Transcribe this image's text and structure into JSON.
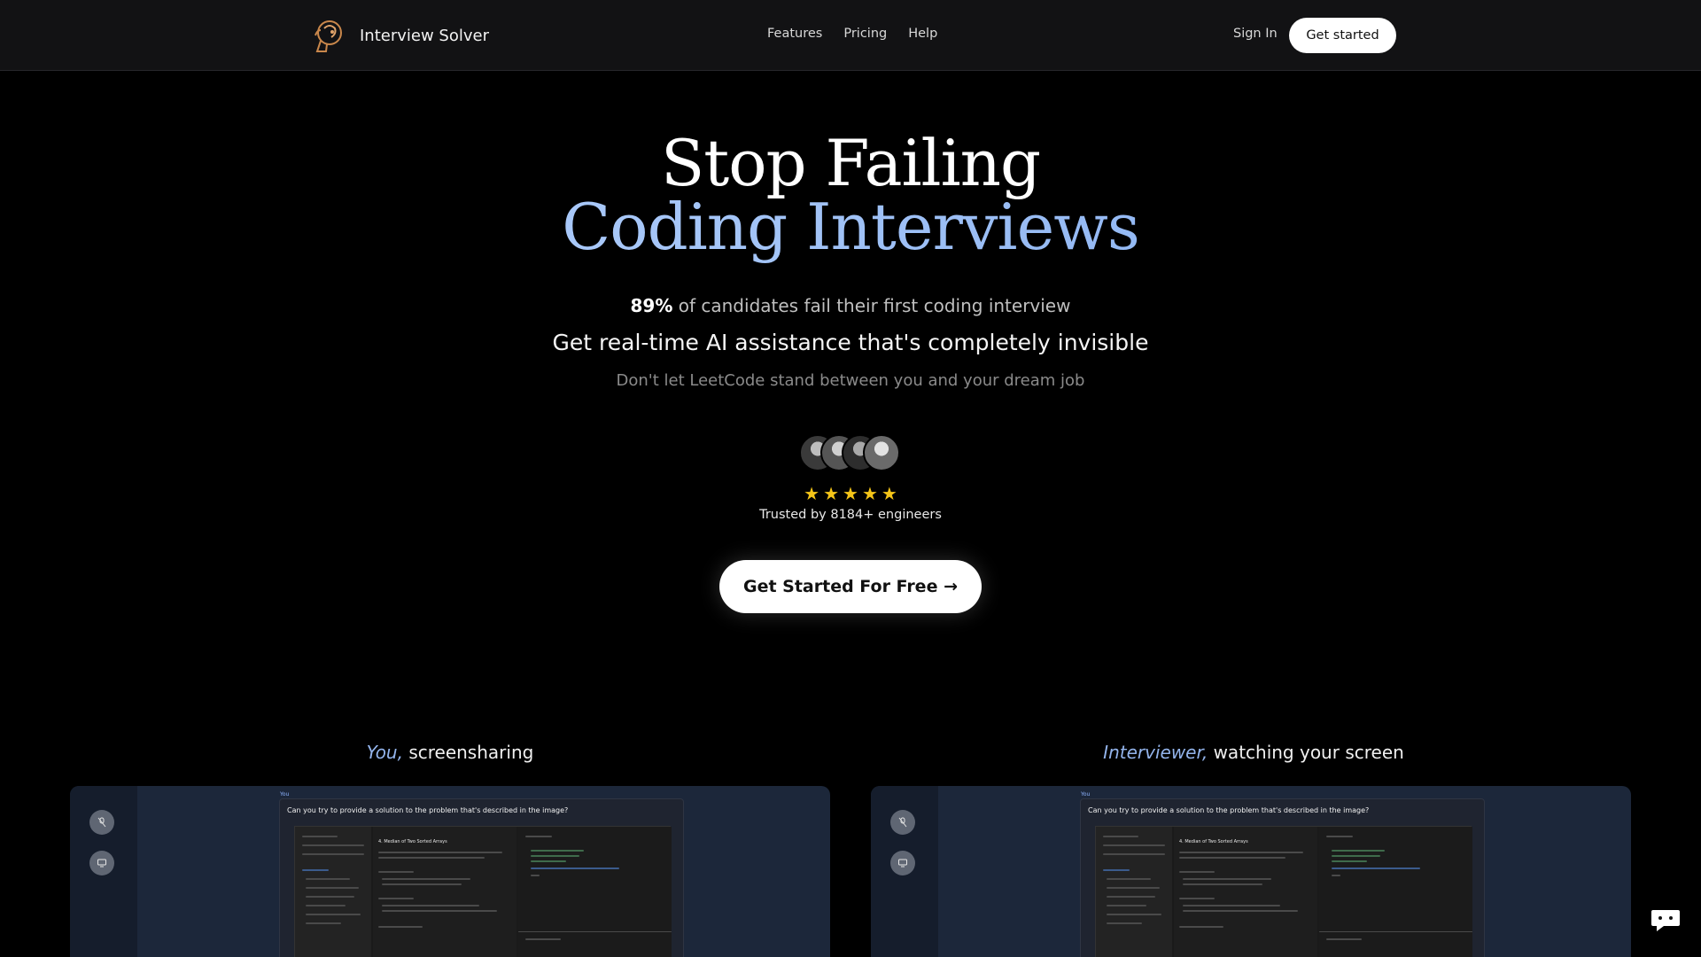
{
  "header": {
    "brand": "Interview Solver",
    "nav": [
      "Features",
      "Pricing",
      "Help"
    ],
    "sign_in": "Sign In",
    "get_started": "Get started"
  },
  "hero": {
    "title_line1": "Stop Failing",
    "title_line2": "Coding Interviews",
    "stat_value": "89%",
    "stat_text": " of candidates fail their first coding interview",
    "subtitle": "Get real-time AI assistance that's completely invisible",
    "tagline": "Don't let LeetCode stand between you and your dream job",
    "rating_stars": 5,
    "trusted": "Trusted by 8184+ engineers",
    "cta": "Get Started For Free →"
  },
  "showcase": {
    "left_caption_em": "You,",
    "left_caption": " screensharing",
    "right_caption_em": "Interviewer,",
    "right_caption": " watching your screen",
    "you_tag": "You",
    "question": "Can you try to provide a solution to the problem that's described in the image?",
    "problem_title": "4. Median of Two Sorted Arrays"
  },
  "colors": {
    "background": "#000000",
    "header_bg": "#121214",
    "accent_blue": "#93b4ec",
    "star": "#f5c518"
  },
  "icons": [
    "logo-mark-icon",
    "star-icon",
    "microphone-off-icon",
    "monitor-icon",
    "chat-icon",
    "arrow-right-icon"
  ]
}
